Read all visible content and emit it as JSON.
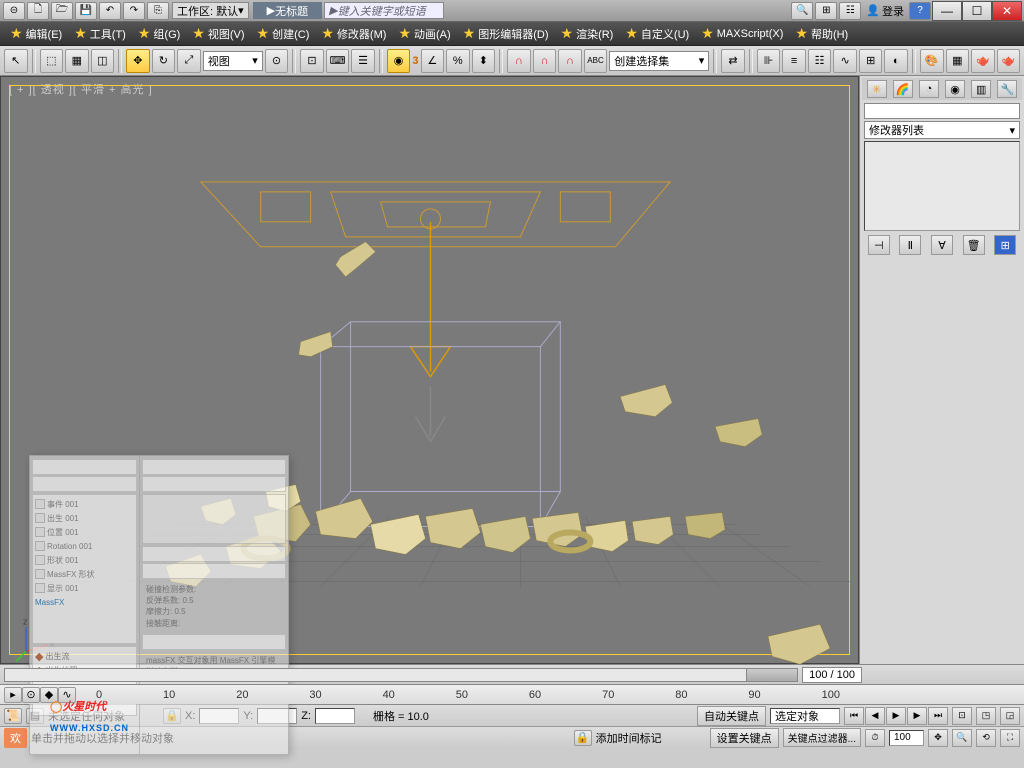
{
  "titlebar": {
    "workspace_label": "工作区: 默认",
    "title": "无标题",
    "search_placeholder": "键入关键字或短语",
    "login": "登录"
  },
  "menus": [
    "编辑(E)",
    "工具(T)",
    "组(G)",
    "视图(V)",
    "创建(C)",
    "修改器(M)",
    "动画(A)",
    "图形编辑器(D)",
    "渲染(R)",
    "自定义(U)",
    "MAXScript(X)",
    "帮助(H)"
  ],
  "toolbar": {
    "view_label": "视图",
    "snap_label": "3",
    "selset_label": "创建选择集"
  },
  "viewport": {
    "label": "[ + ][ 透视 ][ 平滑 + 高光 ]"
  },
  "side": {
    "modlist": "修改器列表"
  },
  "timeline": {
    "counter": "100 / 100",
    "ticks": [
      "0",
      "10",
      "20",
      "30",
      "40",
      "50",
      "60",
      "70",
      "80",
      "90",
      "100"
    ]
  },
  "status": {
    "none_selected": "未选定任何对象",
    "x_label": "X:",
    "y_label": "Y:",
    "z_label": "Z:",
    "grid_label": "栅格 = 10.0",
    "autokey": "自动关键点",
    "selobj": "选定对象",
    "prompt": "单击并拖动以选择并移动对象",
    "addtime": "添加时间标记",
    "setkey": "设置关键点",
    "keyfilter": "关键点过滤器...",
    "frame": "100",
    "welcome": "欢"
  },
  "watermark": {
    "brand": "火星时代",
    "url": "WWW.HXSD.CN"
  }
}
